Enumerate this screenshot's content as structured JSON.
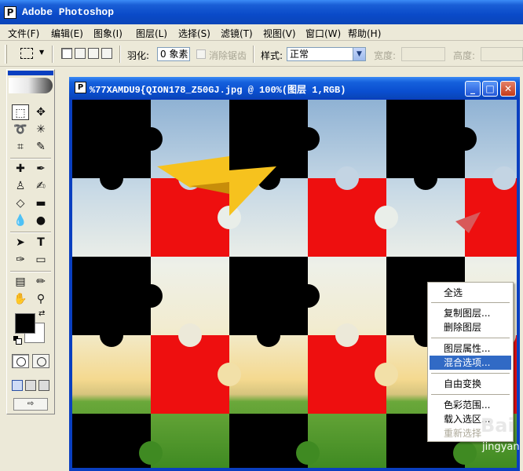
{
  "app": {
    "title": "Adobe Photoshop"
  },
  "menu": [
    "文件(F)",
    "编辑(E)",
    "图象(I)",
    "图层(L)",
    "选择(S)",
    "滤镜(T)",
    "视图(V)",
    "窗口(W)",
    "帮助(H)"
  ],
  "options": {
    "feather_label": "羽化:",
    "feather_value": "0 象素",
    "antialias_label": "消除锯齿",
    "style_label": "样式:",
    "style_value": "正常",
    "width_label": "宽度:",
    "height_label": "高度:"
  },
  "document": {
    "title": "%77XAMDU9{QION178_Z50GJ.jpg @ 100%(图层 1,RGB)"
  },
  "context_menu": {
    "items": [
      "全选",
      "复制图层...",
      "删除图层",
      "图层属性...",
      "混合选项...",
      "自由变换",
      "色彩范围...",
      "载入选区...",
      "重新选择"
    ],
    "highlighted": "混合选项..."
  },
  "watermark": {
    "brand": "Bai",
    "sub": "jingyan"
  },
  "colors": {
    "tile_black": "#000000",
    "tile_red": "#ee0f0f",
    "accent_blue": "#316ac5"
  }
}
